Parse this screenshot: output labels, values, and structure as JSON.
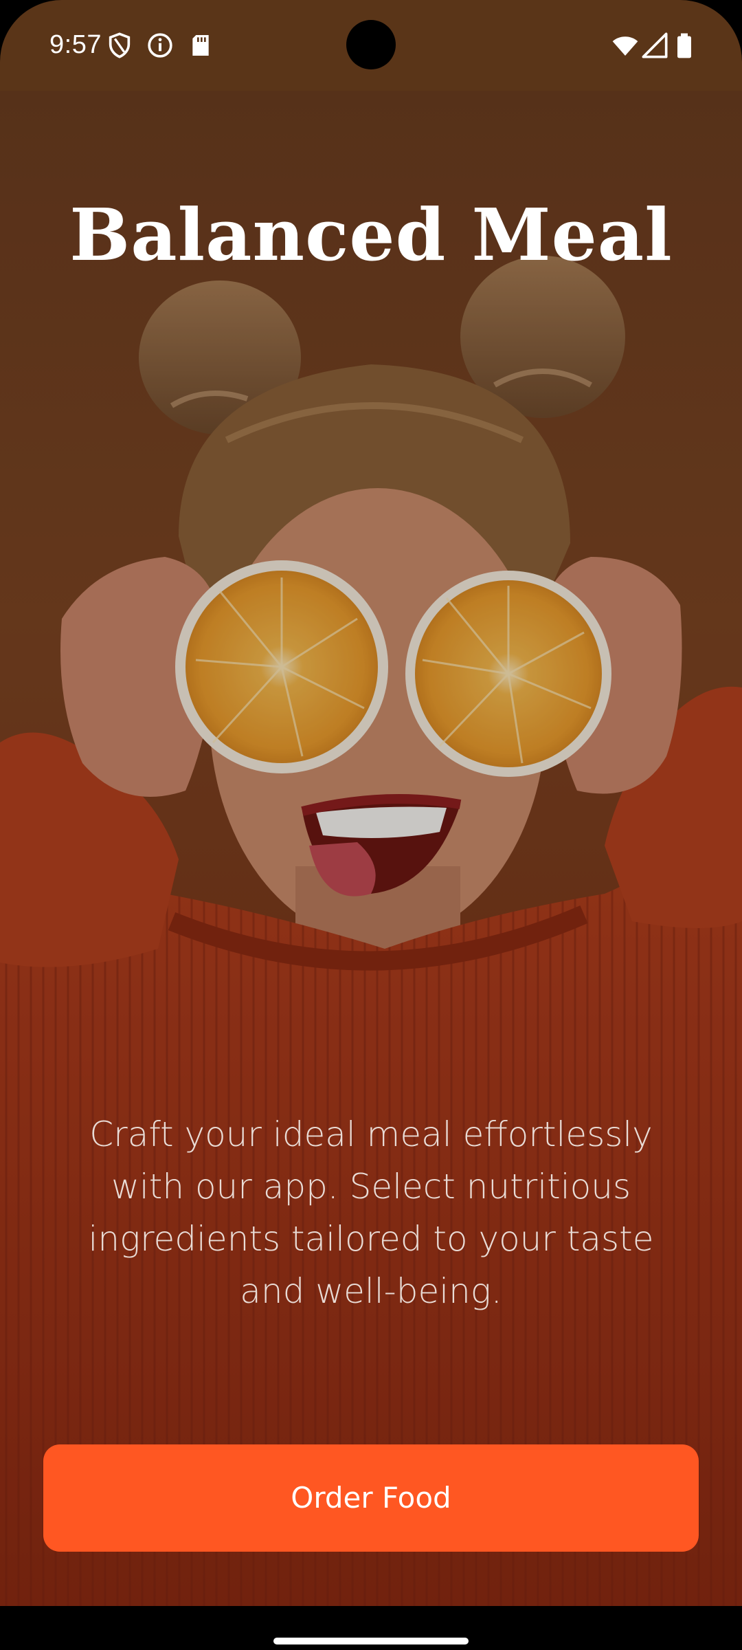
{
  "status_bar": {
    "time": "9:57",
    "left_icons": [
      "shield-icon",
      "info-icon",
      "sd-card-icon"
    ],
    "right_icons": [
      "wifi-icon",
      "cellular-signal-icon",
      "battery-icon"
    ]
  },
  "hero": {
    "image": "woman-holding-orange-halves-over-eyes"
  },
  "main": {
    "title": "Balanced Meal",
    "description": "Craft your ideal meal effortlessly with our app. Select nutritious ingredients tailored to your taste and well-being.",
    "cta_label": "Order Food"
  },
  "colors": {
    "accent": "#ff5722",
    "status_bar_bg": "#5a3518",
    "hero_bg": "#7a4422",
    "sweater": "#b8401f"
  }
}
